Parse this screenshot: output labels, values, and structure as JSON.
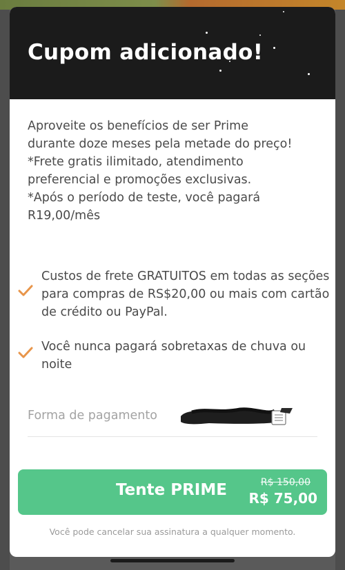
{
  "modal": {
    "title": "Cupom adicionado!",
    "description": "Aproveite os benefícios de ser Prime\ndurante doze meses pela metade do preço!\n*Frete gratis ilimitado, atendimento\npreferencial e promoções exclusivas.\n*Após o período de teste, você pagará\nR19,00/mês"
  },
  "benefits": [
    {
      "icon": "check-icon",
      "text": "Custos de frete GRATUITOS em todas as seções para compras de RS$20,00 ou mais com cartão de crédito ou PayPal."
    },
    {
      "icon": "check-icon",
      "text": "Você nunca pagará sobretaxas de chuva ou noite"
    }
  ],
  "payment": {
    "label": "Forma de pagamento",
    "card_icon": "credit-card-icon"
  },
  "cta": {
    "label": "Tente PRIME",
    "price_old": "R$ 150,00",
    "price_new": "R$ 75,00"
  },
  "footnote": "Você pode cancelar sua assinatura a qualquer momento.",
  "colors": {
    "header_bg": "#1b1b1b",
    "accent_green": "#55c68a",
    "check_orange": "#e8954a",
    "text": "#4a4a4a"
  }
}
